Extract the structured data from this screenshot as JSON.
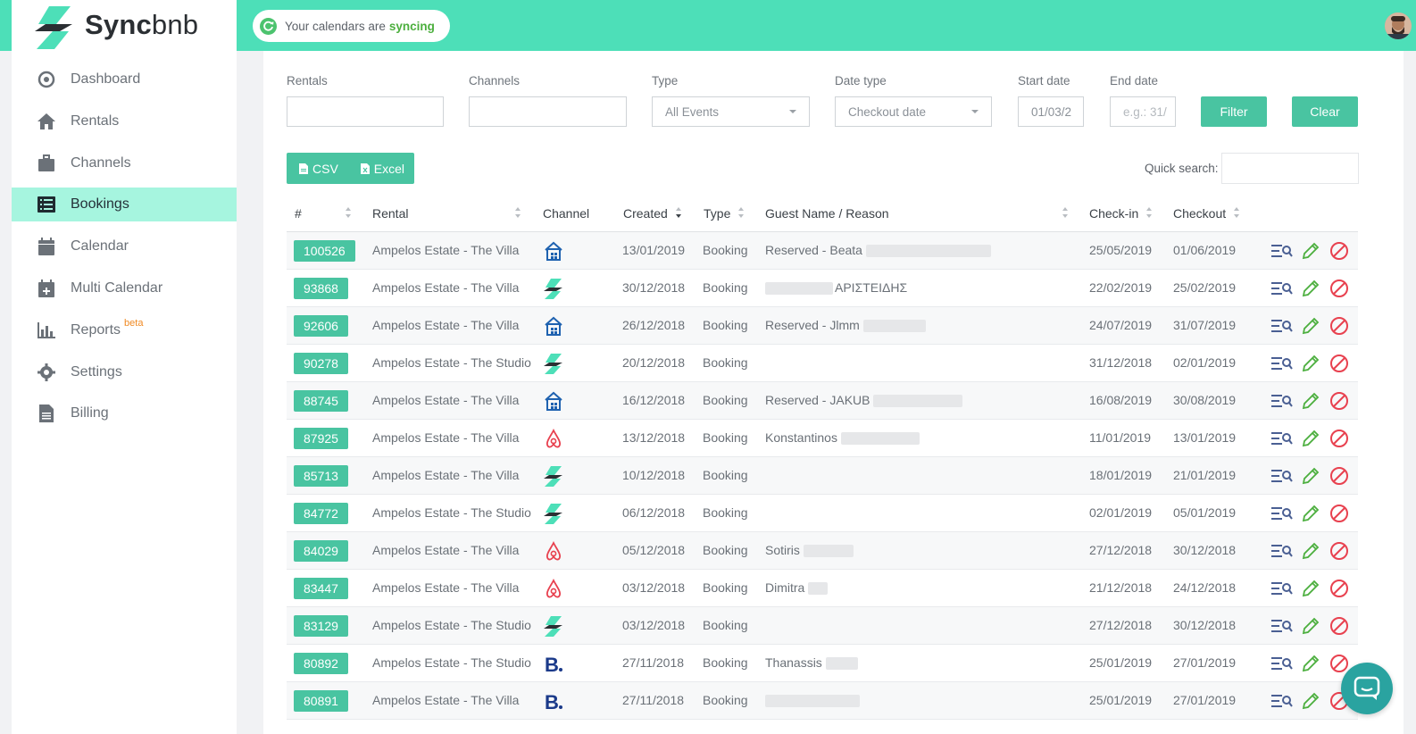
{
  "brand": {
    "name_bold": "Sync",
    "name_rest": "bnb",
    "accent": "#4ddfb8",
    "green": "#49c4a1"
  },
  "status": {
    "prefix": "Your calendars are",
    "state": "syncing"
  },
  "sidebar": {
    "items": [
      {
        "label": "Dashboard",
        "icon": "dashboard-icon"
      },
      {
        "label": "Rentals",
        "icon": "home-icon"
      },
      {
        "label": "Channels",
        "icon": "briefcase-icon"
      },
      {
        "label": "Bookings",
        "icon": "list-icon",
        "active": true
      },
      {
        "label": "Calendar",
        "icon": "calendar-icon"
      },
      {
        "label": "Multi Calendar",
        "icon": "calendar-plus-icon"
      },
      {
        "label": "Reports",
        "icon": "bar-chart-icon",
        "badge": "beta"
      },
      {
        "label": "Settings",
        "icon": "gear-icon"
      },
      {
        "label": "Billing",
        "icon": "file-icon"
      }
    ]
  },
  "filters": {
    "rentals_label": "Rentals",
    "channels_label": "Channels",
    "type_label": "Type",
    "type_value": "All Events",
    "date_type_label": "Date type",
    "date_type_value": "Checkout date",
    "start_label": "Start date",
    "start_value": "01/03/2",
    "end_label": "End date",
    "end_placeholder": "e.g.: 31/",
    "filter_btn": "Filter",
    "clear_btn": "Clear"
  },
  "export": {
    "csv": "CSV",
    "excel": "Excel"
  },
  "quick_search_label": "Quick search:",
  "table": {
    "headers": {
      "num": "#",
      "rental": "Rental",
      "channel": "Channel",
      "created": "Created",
      "type": "Type",
      "guest": "Guest Name / Reason",
      "checkin": "Check-in",
      "checkout": "Checkout"
    },
    "rows": [
      {
        "id": "100526",
        "rental": "Ampelos Estate - The Villa",
        "channel": "homeaway",
        "created": "13/01/2019",
        "type": "Booking",
        "guest": "Reserved - Beata",
        "checkin": "25/05/2019",
        "checkout": "01/06/2019"
      },
      {
        "id": "93868",
        "rental": "Ampelos Estate - The Villa",
        "channel": "syncbnb",
        "created": "30/12/2018",
        "type": "Booking",
        "guest": "ΑΡΙΣΤΕΙΔΗΣ",
        "checkin": "22/02/2019",
        "checkout": "25/02/2019"
      },
      {
        "id": "92606",
        "rental": "Ampelos Estate - The Villa",
        "channel": "homeaway",
        "created": "26/12/2018",
        "type": "Booking",
        "guest": "Reserved - Jlmm",
        "checkin": "24/07/2019",
        "checkout": "31/07/2019"
      },
      {
        "id": "90278",
        "rental": "Ampelos Estate - The Studio",
        "channel": "syncbnb",
        "created": "20/12/2018",
        "type": "Booking",
        "guest": "",
        "checkin": "31/12/2018",
        "checkout": "02/01/2019"
      },
      {
        "id": "88745",
        "rental": "Ampelos Estate - The Villa",
        "channel": "homeaway",
        "created": "16/12/2018",
        "type": "Booking",
        "guest": "Reserved - JAKUB",
        "checkin": "16/08/2019",
        "checkout": "30/08/2019"
      },
      {
        "id": "87925",
        "rental": "Ampelos Estate - The Villa",
        "channel": "airbnb",
        "created": "13/12/2018",
        "type": "Booking",
        "guest": "Konstantinos",
        "checkin": "11/01/2019",
        "checkout": "13/01/2019"
      },
      {
        "id": "85713",
        "rental": "Ampelos Estate - The Villa",
        "channel": "syncbnb",
        "created": "10/12/2018",
        "type": "Booking",
        "guest": "",
        "checkin": "18/01/2019",
        "checkout": "21/01/2019"
      },
      {
        "id": "84772",
        "rental": "Ampelos Estate - The Studio",
        "channel": "syncbnb",
        "created": "06/12/2018",
        "type": "Booking",
        "guest": "",
        "checkin": "02/01/2019",
        "checkout": "05/01/2019"
      },
      {
        "id": "84029",
        "rental": "Ampelos Estate - The Villa",
        "channel": "airbnb",
        "created": "05/12/2018",
        "type": "Booking",
        "guest": "Sotiris",
        "checkin": "27/12/2018",
        "checkout": "30/12/2018"
      },
      {
        "id": "83447",
        "rental": "Ampelos Estate - The Villa",
        "channel": "airbnb",
        "created": "03/12/2018",
        "type": "Booking",
        "guest": "Dimitra",
        "checkin": "21/12/2018",
        "checkout": "24/12/2018"
      },
      {
        "id": "83129",
        "rental": "Ampelos Estate - The Studio",
        "channel": "syncbnb",
        "created": "03/12/2018",
        "type": "Booking",
        "guest": "",
        "checkin": "27/12/2018",
        "checkout": "30/12/2018"
      },
      {
        "id": "80892",
        "rental": "Ampelos Estate - The Studio",
        "channel": "booking",
        "created": "27/11/2018",
        "type": "Booking",
        "guest": "Thanassis",
        "checkin": "25/01/2019",
        "checkout": "27/01/2019"
      },
      {
        "id": "80891",
        "rental": "Ampelos Estate - The Villa",
        "channel": "booking",
        "created": "27/11/2018",
        "type": "Booking",
        "guest": "",
        "checkin": "25/01/2019",
        "checkout": "27/01/2019"
      }
    ]
  }
}
